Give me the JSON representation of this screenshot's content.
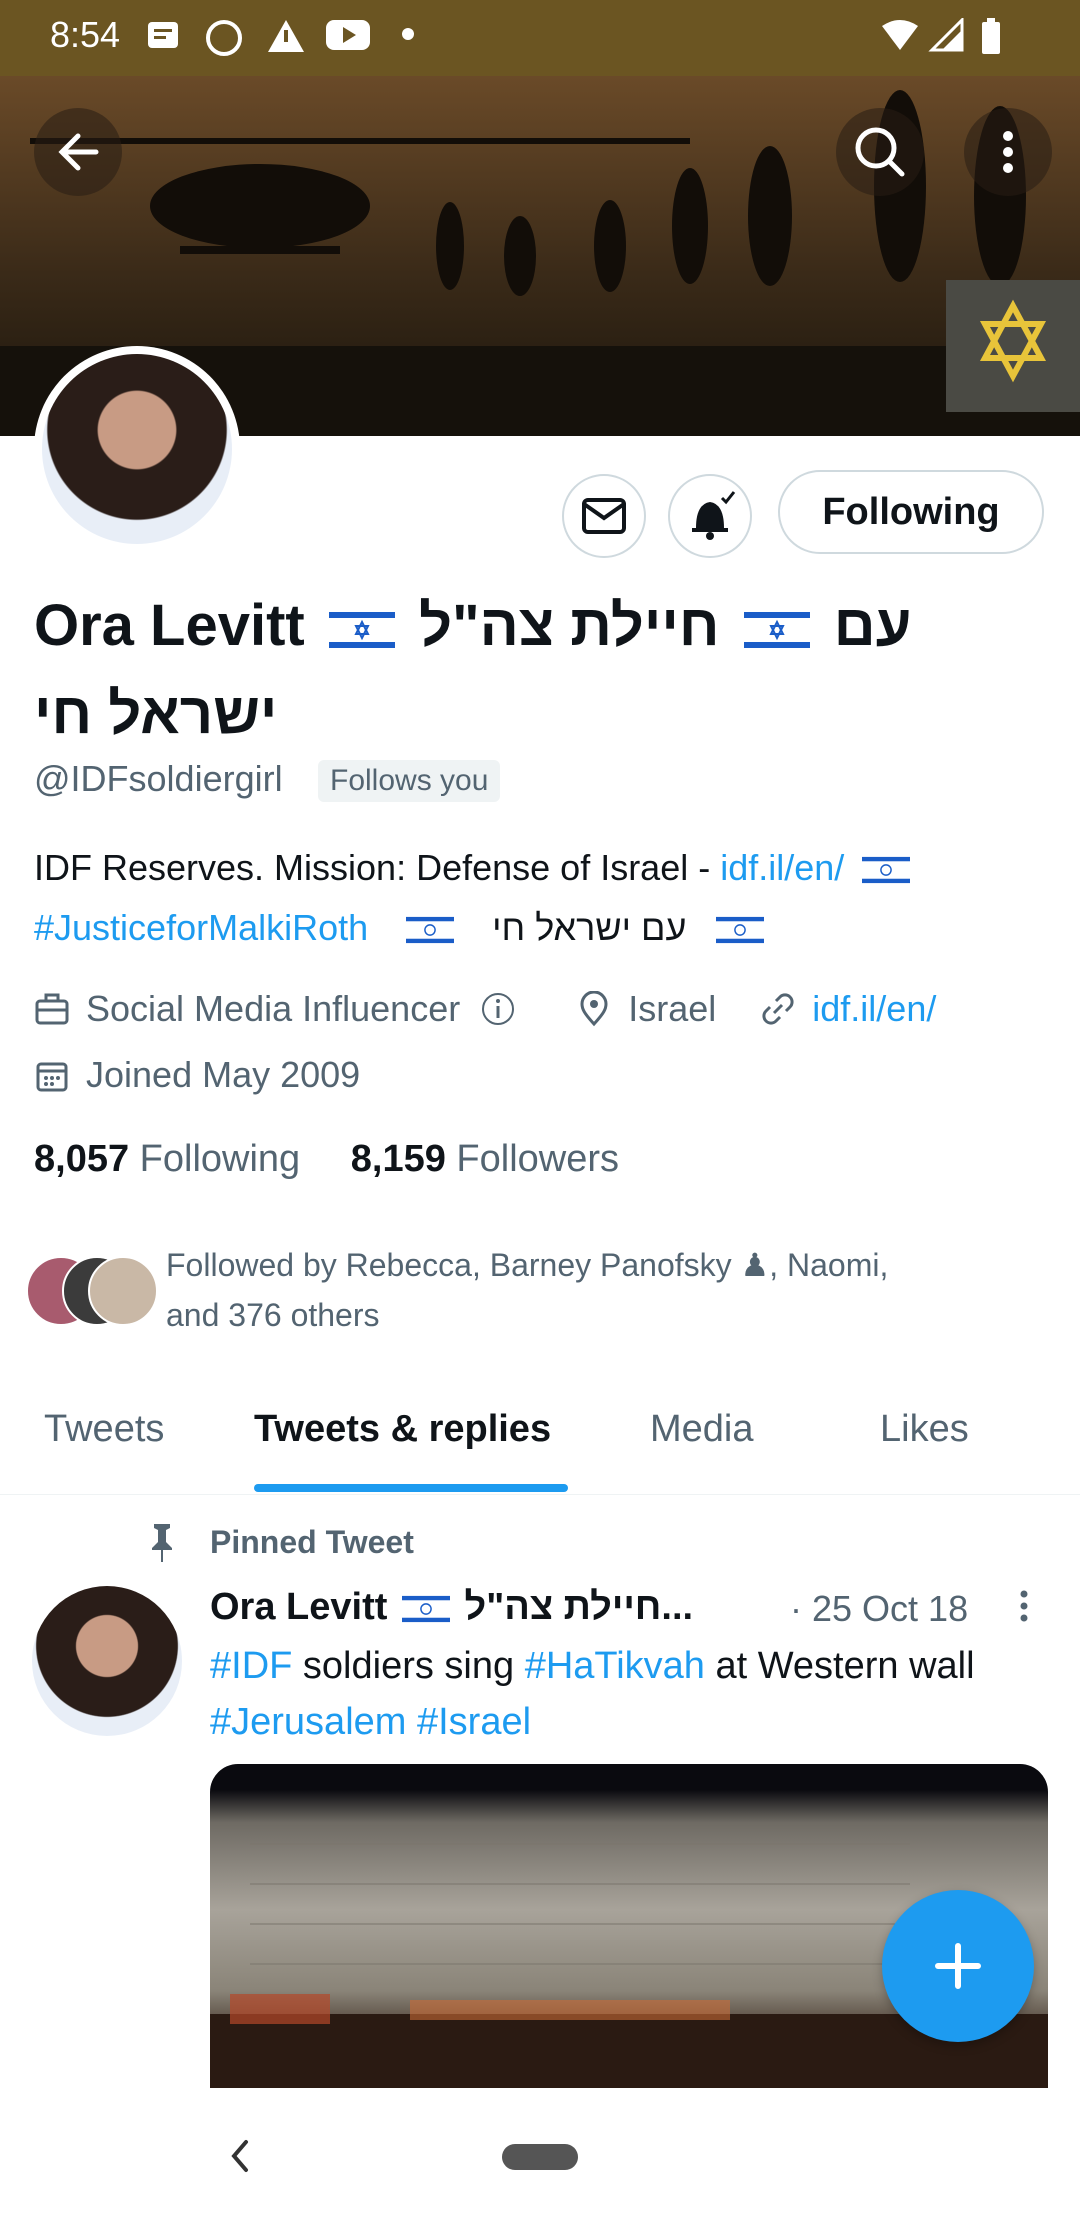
{
  "status_bar": {
    "time": "8:54"
  },
  "profile": {
    "name_part1": "Ora Levitt",
    "name_part2": "עם",
    "name_part3": "חיילת צה\"ל",
    "name_line2": "ישראל חי",
    "handle": "@IDFsoldiergirl",
    "follows_you": "Follows you",
    "follow_button": "Following",
    "bio_line1_text": "IDF Reserves. Mission: Defense of Israel - ",
    "bio_line1_link": "idf.il/en/",
    "bio_line2_hashtag": "#JusticeforMalkiRoth",
    "bio_line2_hebrew": "עם ישראל חי",
    "category": "Social Media Influencer",
    "location": "Israel",
    "website": "idf.il/en/",
    "joined": "Joined May 2009",
    "following_count": "8,057",
    "following_label": "Following",
    "followers_count": "8,159",
    "followers_label": "Followers",
    "followed_by_line1": "Followed by Rebecca, Barney Panofsky ♟, Naomi,",
    "followed_by_line2": "and 376 others"
  },
  "tabs": [
    {
      "label": "Tweets"
    },
    {
      "label": "Tweets & replies",
      "active": true
    },
    {
      "label": "Media"
    },
    {
      "label": "Likes"
    }
  ],
  "pinned_tweet": {
    "pinned_label": "Pinned Tweet",
    "author": "Ora Levitt",
    "author_hebrew": "חיילת צה\"ל...",
    "date": "· 25 Oct 18",
    "text_hashtag1": "#IDF",
    "text_middle1": " soldiers sing ",
    "text_hashtag2": "#HaTikvah",
    "text_middle2": " at Western wall",
    "text_hashtag3": "#Jerusalem",
    "text_hashtag4": "#Israel"
  },
  "colors": {
    "accent": "#1d9bf0",
    "status_bar": "#6b5522",
    "text": "#0f1419",
    "secondary": "#536471"
  }
}
